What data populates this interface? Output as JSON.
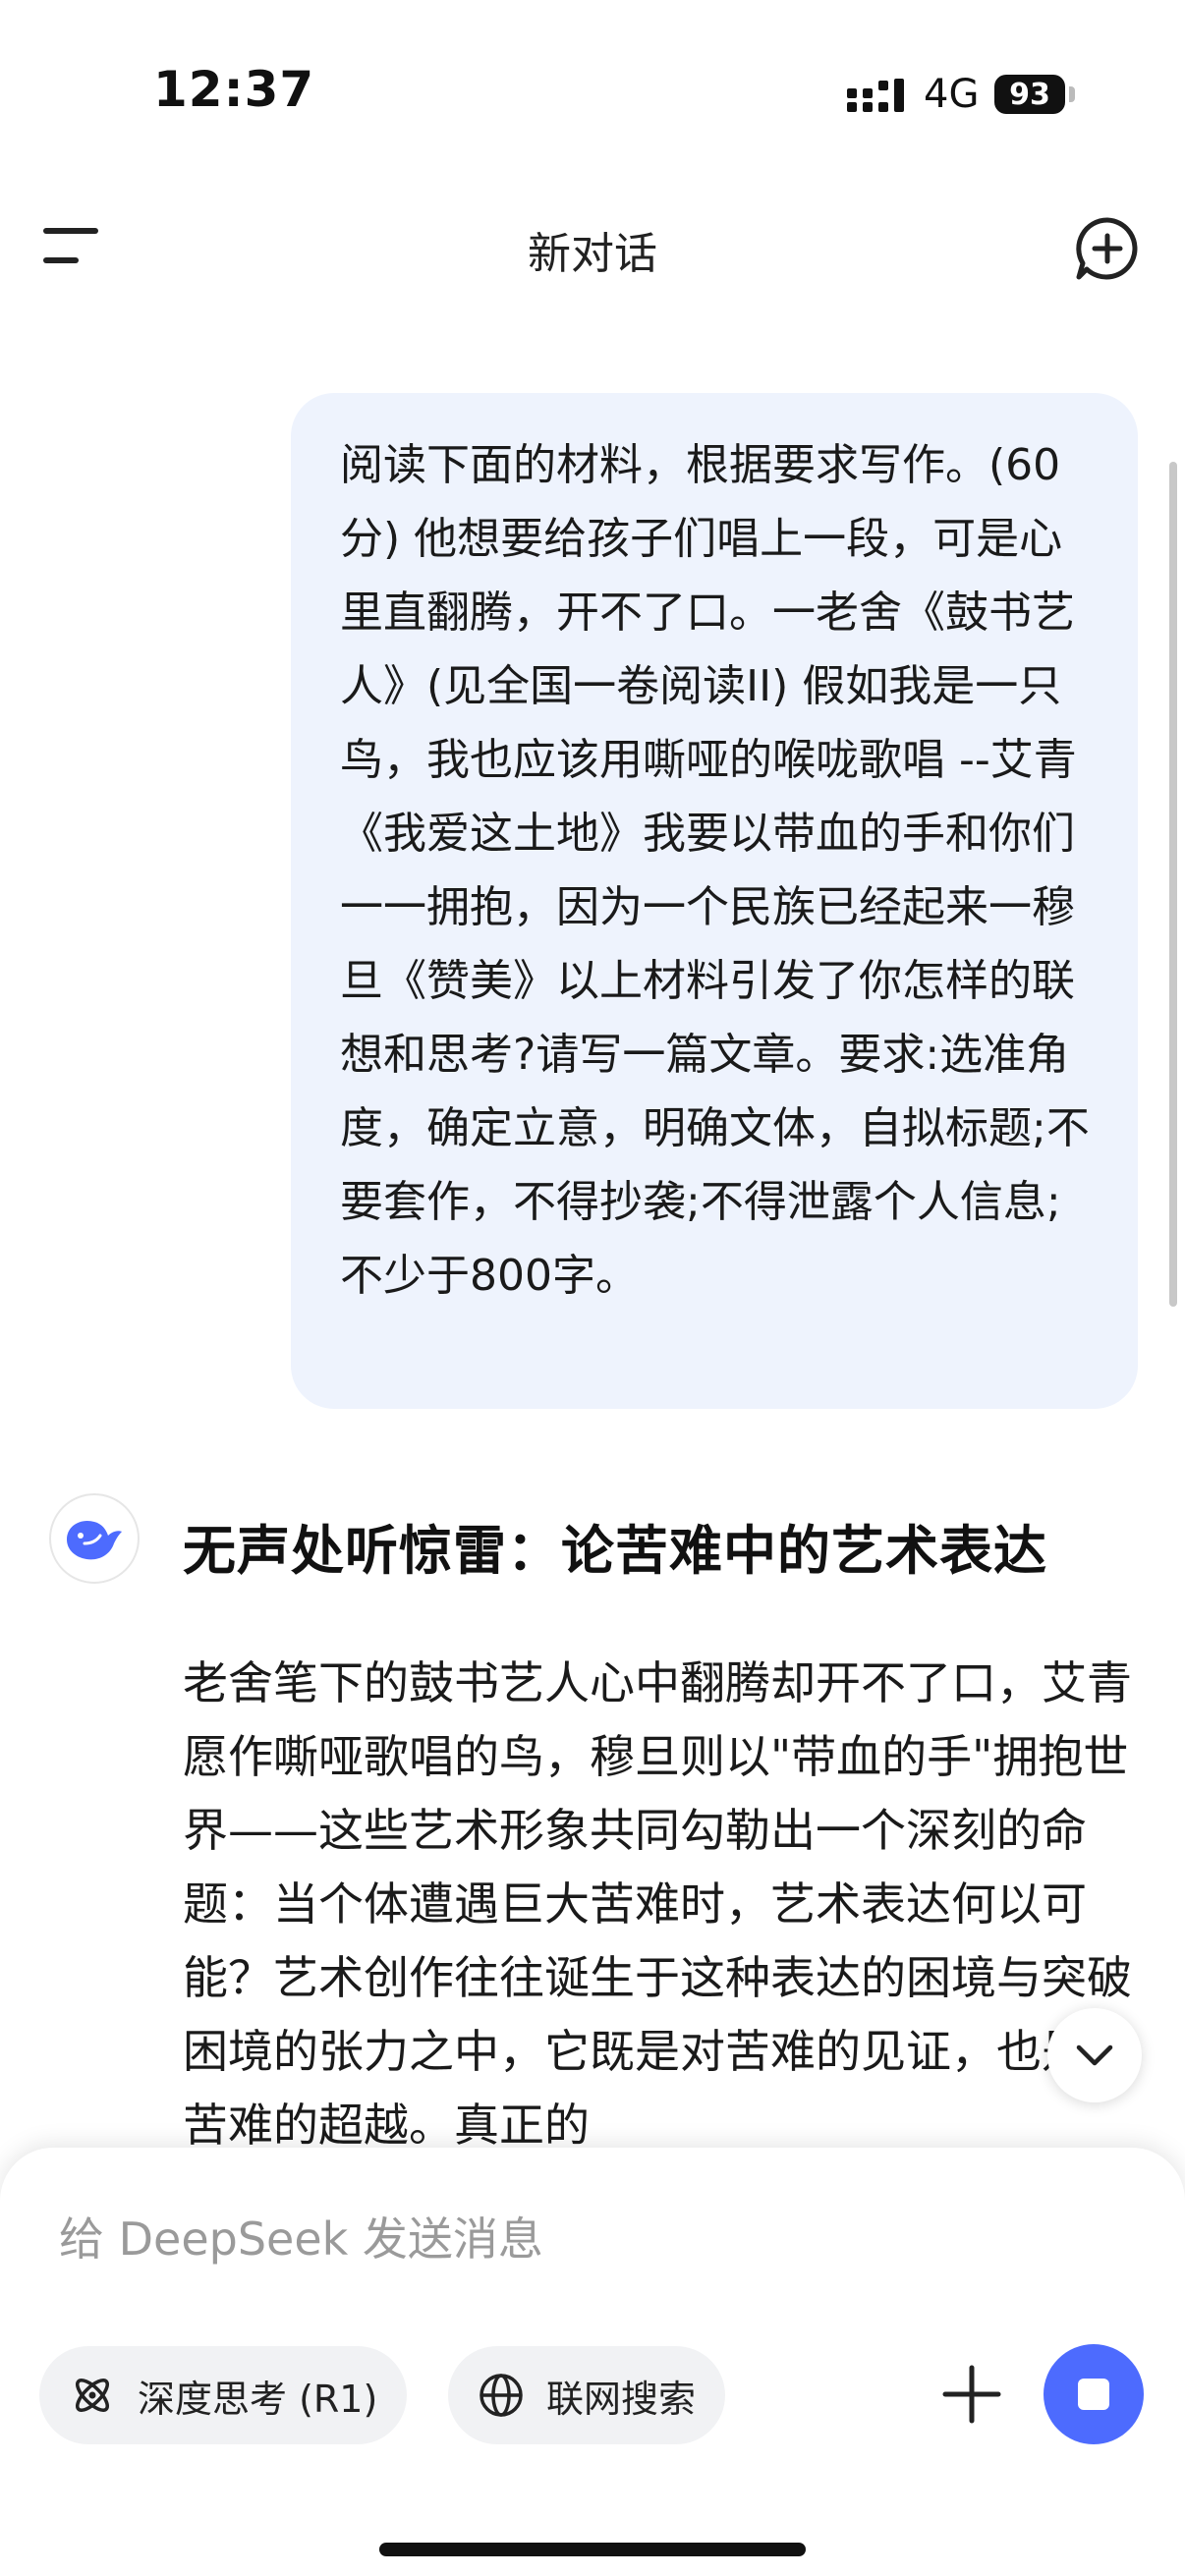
{
  "status_bar": {
    "time": "12:37",
    "network": "4G",
    "battery": "93"
  },
  "header": {
    "title": "新对话",
    "menu_icon": "menu-icon",
    "new_chat_icon": "new-chat-icon"
  },
  "user_message": {
    "text": "阅读下面的材料，根据要求写作。(60分) 他想要给孩子们唱上一段，可是心里直翻腾，开不了口。一老舍《鼓书艺人》(见全国一卷阅读II) 假如我是一只鸟，我也应该用嘶哑的喉咙歌唱 --艾青《我爱这土地》我要以带血的手和你们一一拥抱，因为一个民族已经起来一穆旦《赞美》以上材料引发了你怎样的联想和思考?请写一篇文章。要求:选准角度，确定立意，明确文体，自拟标题;不要套作，不得抄袭;不得泄露个人信息;不少于800字。"
  },
  "assistant_message": {
    "title": "无声处听惊雷：论苦难中的艺术表达",
    "body": "老舍笔下的鼓书艺人心中翻腾却开不了口，艾青愿作嘶哑歌唱的鸟，穆旦则以\"带血的手\"拥抱世界——这些艺术形象共同勾勒出一个深刻的命题：当个体遭遇巨大苦难时，艺术表达何以可能？艺术创作往往诞生于这种表达的困境与突破困境的张力之中，它既是对苦难的见证，也是对苦难的超越。真正的"
  },
  "composer": {
    "placeholder": "给 DeepSeek 发送消息",
    "deep_think_label": "深度思考 (R1)",
    "web_search_label": "联网搜索"
  },
  "colors": {
    "accent": "#4d6bfe",
    "user_bubble": "#eef3fd"
  }
}
